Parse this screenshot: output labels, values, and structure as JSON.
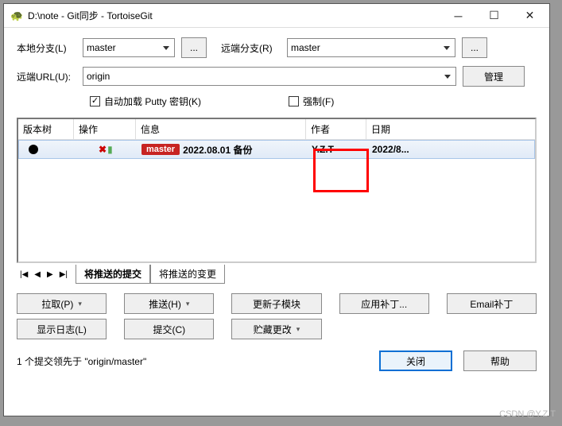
{
  "window": {
    "title": "D:\\note - Git同步 - TortoiseGit"
  },
  "form": {
    "local_branch_label": "本地分支(L)",
    "local_branch_value": "master",
    "remote_branch_label": "远端分支(R)",
    "remote_branch_value": "master",
    "remote_url_label": "远端URL(U):",
    "remote_url_value": "origin",
    "manage_btn": "管理",
    "dots": "...",
    "checkbox_putty": "自动加载 Putty 密钥(K)",
    "checkbox_force": "强制(F)"
  },
  "table": {
    "headers": {
      "tree": "版本树",
      "op": "操作",
      "msg": "信息",
      "author": "作者",
      "date": "日期"
    },
    "row": {
      "branch_tag": "master",
      "message": "2022.08.01 备份",
      "author": "Y.Z.T",
      "date": "2022/8..."
    }
  },
  "tabs": {
    "tab1": "将推送的提交",
    "tab2": "将推送的变更"
  },
  "buttons": {
    "pull": "拉取(P)",
    "push": "推送(H)",
    "submodule": "更新子模块",
    "apply_patch": "应用补丁...",
    "email_patch": "Email补丁",
    "show_log": "显示日志(L)",
    "commit": "提交(C)",
    "stash": "贮藏更改",
    "close": "关闭",
    "help": "帮助"
  },
  "status": "1 个提交领先于 \"origin/master\"",
  "watermark": "CSDN @Y.Z.T"
}
